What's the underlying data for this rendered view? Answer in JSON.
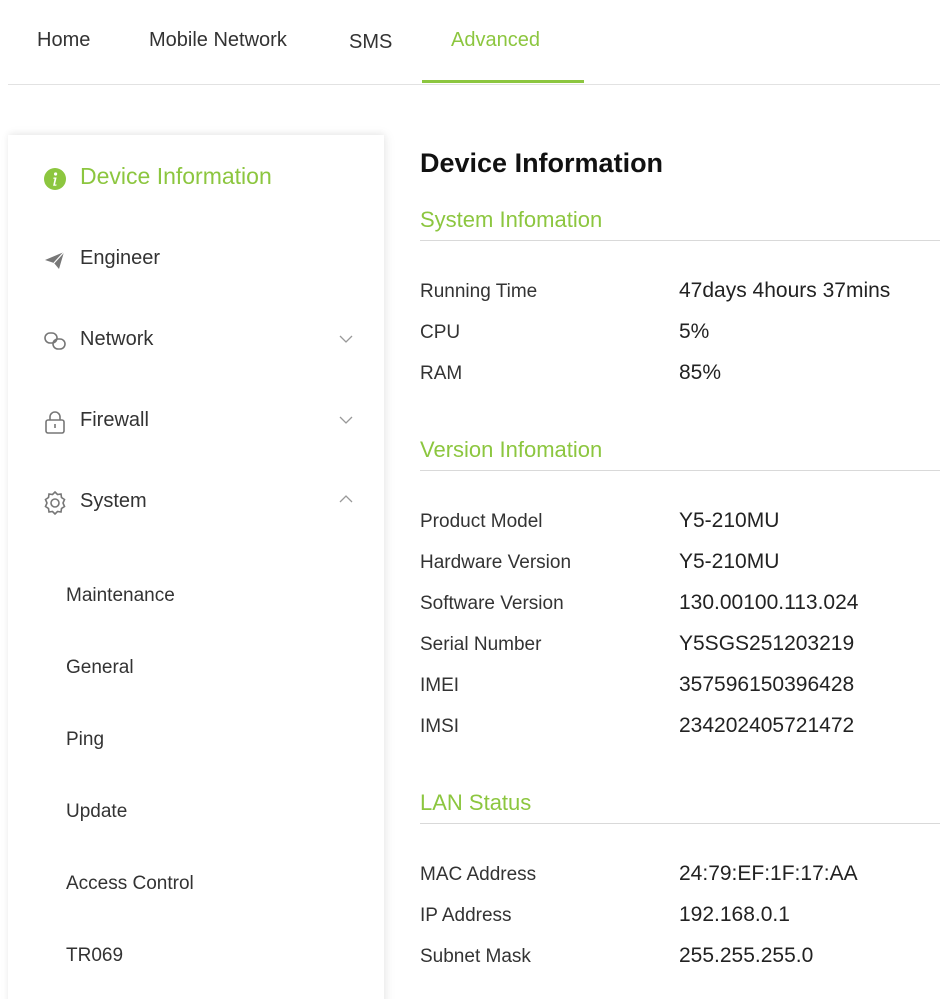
{
  "topnav": {
    "tabs": [
      {
        "label": "Home"
      },
      {
        "label": "Mobile Network"
      },
      {
        "label": "SMS"
      },
      {
        "label": "Advanced"
      }
    ],
    "active_tab": "Advanced"
  },
  "sidebar": {
    "items": [
      {
        "label": "Device Information",
        "icon": "info-icon"
      },
      {
        "label": "Engineer",
        "icon": "paper-plane-icon"
      },
      {
        "label": "Network",
        "icon": "link-icon",
        "chevron": "chevron-down-icon"
      },
      {
        "label": "Firewall",
        "icon": "lock-icon",
        "chevron": "chevron-down-icon"
      },
      {
        "label": "System",
        "icon": "gear-icon",
        "chevron": "chevron-up-icon"
      }
    ],
    "system_subitems": [
      {
        "label": "Maintenance"
      },
      {
        "label": "General"
      },
      {
        "label": "Ping"
      },
      {
        "label": "Update"
      },
      {
        "label": "Access Control"
      },
      {
        "label": "TR069"
      }
    ]
  },
  "main": {
    "title": "Device Information",
    "system": {
      "title": "System Infomation",
      "rows": [
        {
          "label": "Running Time",
          "value": "47days 4hours 37mins"
        },
        {
          "label": "CPU",
          "value": "5%"
        },
        {
          "label": "RAM",
          "value": "85%"
        }
      ]
    },
    "version": {
      "title": "Version Infomation",
      "rows": [
        {
          "label": "Product Model",
          "value": "Y5-210MU"
        },
        {
          "label": "Hardware Version",
          "value": "Y5-210MU"
        },
        {
          "label": "Software Version",
          "value": "130.00100.113.024"
        },
        {
          "label": "Serial Number",
          "value": "Y5SGS251203219"
        },
        {
          "label": "IMEI",
          "value": "357596150396428"
        },
        {
          "label": "IMSI",
          "value": "234202405721472"
        }
      ]
    },
    "lan": {
      "title": "LAN Status",
      "rows": [
        {
          "label": "MAC Address",
          "value": "24:79:EF:1F:17:AA"
        },
        {
          "label": "IP Address",
          "value": "192.168.0.1"
        },
        {
          "label": "Subnet Mask",
          "value": "255.255.255.0"
        }
      ]
    }
  },
  "colors": {
    "accent": "#8cc63f",
    "text": "#333333",
    "divider": "#d9d9d9"
  }
}
